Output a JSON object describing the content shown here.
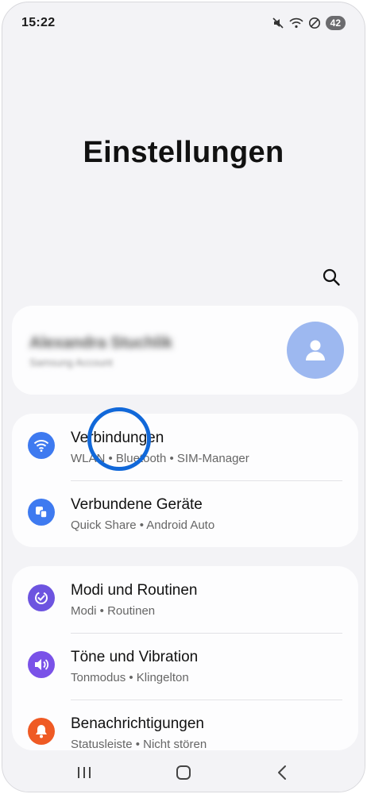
{
  "status_bar": {
    "time": "15:22",
    "battery": "42",
    "icons": [
      "mute-icon",
      "wifi-icon",
      "do-not-disturb-icon",
      "battery-icon"
    ]
  },
  "page": {
    "title": "Einstellungen"
  },
  "search": {
    "icon": "search-icon"
  },
  "profile": {
    "name": "Alexandra Stuchlik",
    "subtitle": "Samsung Account"
  },
  "groups": [
    {
      "items": [
        {
          "title": "Verbindungen",
          "subtitle": "WLAN  •  Bluetooth  •  SIM-Manager",
          "icon": "wifi-icon",
          "color": "#3e7af0"
        },
        {
          "title": "Verbundene Geräte",
          "subtitle": "Quick Share  •  Android Auto",
          "icon": "connected-devices-icon",
          "color": "#3e7af0"
        }
      ]
    },
    {
      "items": [
        {
          "title": "Modi und Routinen",
          "subtitle": "Modi  •  Routinen",
          "icon": "modes-routines-icon",
          "color": "#6d54e0"
        },
        {
          "title": "Töne und Vibration",
          "subtitle": "Tonmodus  •  Klingelton",
          "icon": "sound-icon",
          "color": "#7a52e8"
        },
        {
          "title": "Benachrichtigungen",
          "subtitle": "Statusleiste  •  Nicht stören",
          "icon": "bell-icon",
          "color": "#ef5a24"
        }
      ]
    }
  ],
  "navbar": {
    "icons": [
      "recent-apps-icon",
      "home-icon",
      "back-icon"
    ]
  },
  "colors": {
    "background": "#f3f3f6",
    "card": "#fdfdfe",
    "touch_indicator": "#1168d9"
  }
}
